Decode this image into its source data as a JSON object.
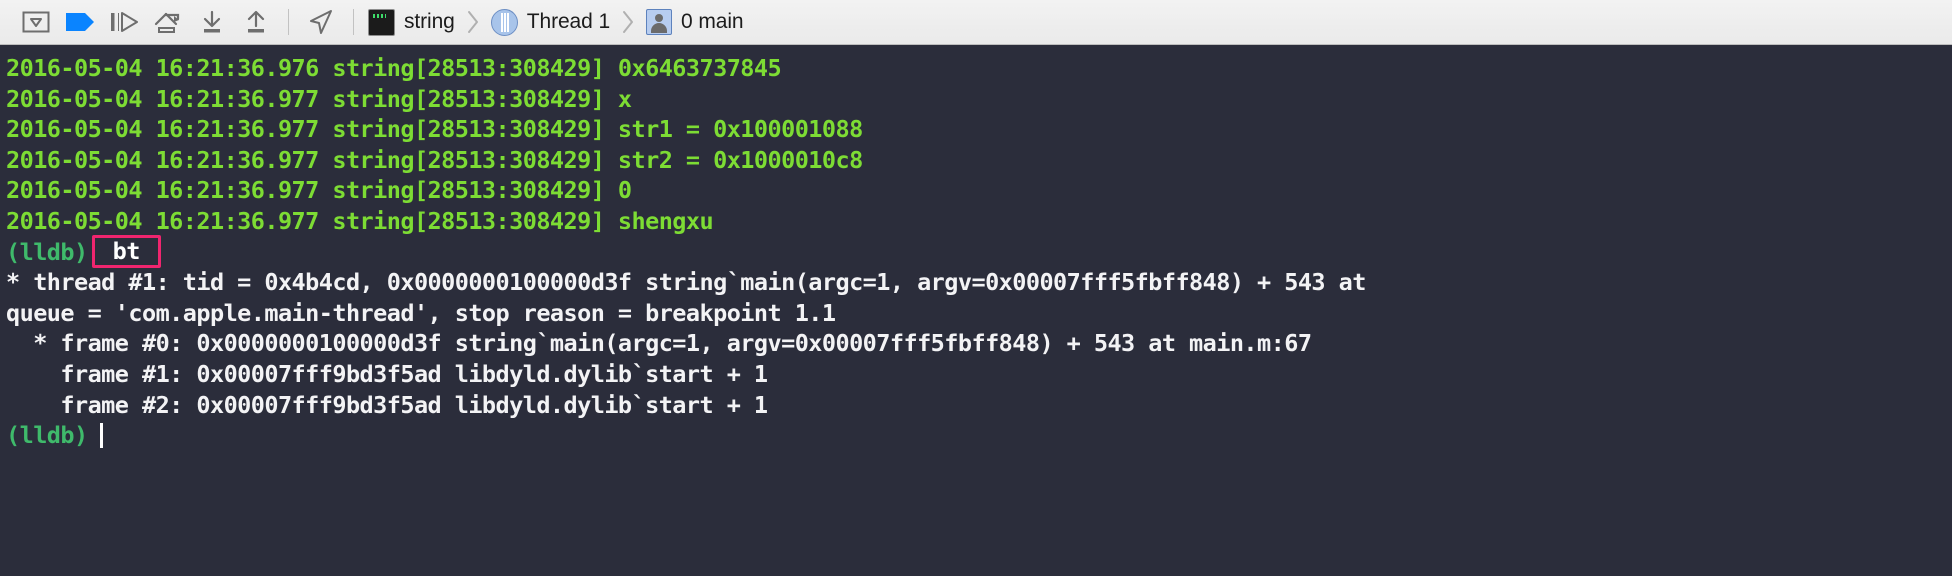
{
  "toolbar": {
    "buttons": [
      {
        "name": "hide-debug-area-button",
        "icon": "panel-collapse-icon",
        "label": "Hide Debug Area"
      },
      {
        "name": "continue-button",
        "icon": "continue-program-icon",
        "label": "Continue program execution"
      },
      {
        "name": "step-over-button",
        "icon": "step-over-icon",
        "label": "Step over"
      },
      {
        "name": "step-into-button",
        "icon": "step-into-icon",
        "label": "Step into"
      },
      {
        "name": "step-out-button",
        "icon": "step-out-icon",
        "label": "Step out"
      },
      {
        "name": "step-out-alt-button",
        "icon": "step-out-alt-icon",
        "label": "Step out alternate"
      },
      {
        "name": "simulate-location-button",
        "icon": "location-arrow-icon",
        "label": "Simulate Location"
      }
    ],
    "breadcrumb": [
      {
        "name": "breadcrumb-process",
        "icon": "target-terminal-icon",
        "label": "string"
      },
      {
        "name": "breadcrumb-thread",
        "icon": "thread-icon",
        "label": "Thread 1"
      },
      {
        "name": "breadcrumb-frame",
        "icon": "stack-frame-person-icon",
        "label": "0 main"
      }
    ],
    "separator_glyph": "›"
  },
  "console": {
    "log_lines": [
      "2016-05-04 16:21:36.976 string[28513:308429] 0x6463737845",
      "2016-05-04 16:21:36.977 string[28513:308429] x",
      "2016-05-04 16:21:36.977 string[28513:308429] str1 = 0x100001088",
      "2016-05-04 16:21:36.977 string[28513:308429] str2 = 0x1000010c8",
      "2016-05-04 16:21:36.977 string[28513:308429] 0",
      "2016-05-04 16:21:36.977 string[28513:308429] shengxu"
    ],
    "prompt": "(lldb)",
    "entered_command": "bt",
    "backtrace_lines": [
      "* thread #1: tid = 0x4b4cd, 0x0000000100000d3f string`main(argc=1, argv=0x00007fff5fbff848) + 543 at",
      "queue = 'com.apple.main-thread', stop reason = breakpoint 1.1",
      "  * frame #0: 0x0000000100000d3f string`main(argc=1, argv=0x00007fff5fbff848) + 543 at main.m:67",
      "    frame #1: 0x00007fff9bd3f5ad libdyld.dylib`start + 1",
      "    frame #2: 0x00007fff9bd3f5ad libdyld.dylib`start + 1"
    ],
    "final_prompt": "(lldb)"
  },
  "colors": {
    "console_background": "#2b2d3b",
    "log_green": "#7ddc34",
    "prompt_green": "#3fba6b",
    "output_white": "#f3f3f5",
    "command_highlight": "#f0256f",
    "toolbar_background": "#eaeaea",
    "continue_blue": "#0a84ff"
  }
}
